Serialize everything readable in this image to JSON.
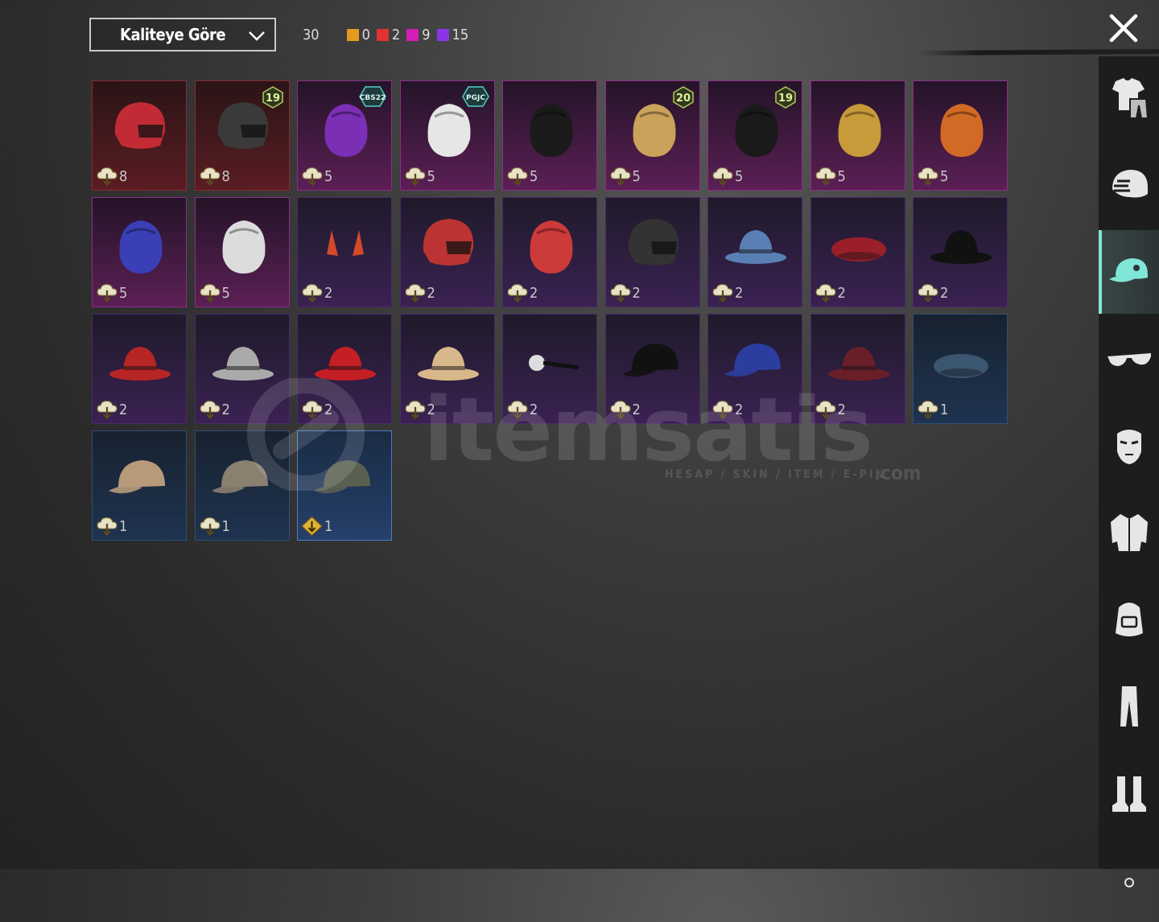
{
  "sort": {
    "label": "Kaliteye Göre"
  },
  "counts": {
    "total": "30",
    "by_quality": [
      {
        "color": "#e49a1c",
        "value": "0"
      },
      {
        "color": "#e23232",
        "value": "2"
      },
      {
        "color": "#d21fb6",
        "value": "9"
      },
      {
        "color": "#8a36e8",
        "value": "15"
      }
    ]
  },
  "items": [
    {
      "name": "red-tech-helmet",
      "quality": "red",
      "count": "8"
    },
    {
      "name": "black-red-helmet",
      "quality": "red",
      "count": "8",
      "badge": "19"
    },
    {
      "name": "purple-blue-hair",
      "quality": "pink",
      "count": "5",
      "badge": "CBS22"
    },
    {
      "name": "panda-mask",
      "quality": "pink",
      "count": "5",
      "badge": "PGJC"
    },
    {
      "name": "black-dreadlocks",
      "quality": "pink",
      "count": "5"
    },
    {
      "name": "blonde-hair-bunny-clip",
      "quality": "pink",
      "count": "5",
      "badge": "20"
    },
    {
      "name": "black-bun-hair",
      "quality": "pink",
      "count": "5",
      "badge": "19"
    },
    {
      "name": "golden-crown-headdress",
      "quality": "pink",
      "count": "5"
    },
    {
      "name": "orange-hair-tiara",
      "quality": "pink",
      "count": "5"
    },
    {
      "name": "blue-wolf-mask",
      "quality": "pink",
      "count": "5"
    },
    {
      "name": "silver-hair-crown",
      "quality": "pink",
      "count": "5"
    },
    {
      "name": "devil-horns",
      "quality": "purple",
      "count": "2"
    },
    {
      "name": "red-retro-helmet",
      "quality": "purple",
      "count": "2"
    },
    {
      "name": "red-white-beanie",
      "quality": "purple",
      "count": "2"
    },
    {
      "name": "luchador-mask",
      "quality": "purple",
      "count": "2"
    },
    {
      "name": "shark-hat",
      "quality": "purple",
      "count": "2"
    },
    {
      "name": "red-beret",
      "quality": "purple",
      "count": "2"
    },
    {
      "name": "black-top-hat",
      "quality": "purple",
      "count": "2"
    },
    {
      "name": "red-fedora",
      "quality": "purple",
      "count": "2"
    },
    {
      "name": "white-shark-hat",
      "quality": "purple",
      "count": "2"
    },
    {
      "name": "red-bucket-hat",
      "quality": "purple",
      "count": "2"
    },
    {
      "name": "cake-hat",
      "quality": "purple",
      "count": "2"
    },
    {
      "name": "head-mirror",
      "quality": "purple",
      "count": "2"
    },
    {
      "name": "black-cap",
      "quality": "purple",
      "count": "2"
    },
    {
      "name": "blue-cap",
      "quality": "purple",
      "count": "2"
    },
    {
      "name": "maroon-fedora",
      "quality": "purple",
      "count": "2"
    },
    {
      "name": "blue-beret",
      "quality": "blue",
      "count": "1"
    },
    {
      "name": "tan-cap",
      "quality": "blue",
      "count": "1"
    },
    {
      "name": "tan-blue-cap",
      "quality": "blue",
      "count": "1"
    },
    {
      "name": "camo-cap-headset",
      "quality": "blue-sel",
      "count": "1"
    }
  ],
  "watermark": {
    "word": "itemsatis",
    "sub": "HESAP / SKIN / ITEM / E-PIN",
    "com": ".com"
  },
  "sidebar": {
    "categories": [
      {
        "id": "outfit",
        "icon": "outfit-icon"
      },
      {
        "id": "helmet",
        "icon": "helmet-icon"
      },
      {
        "id": "hat",
        "icon": "cap-icon",
        "active": true
      },
      {
        "id": "glasses",
        "icon": "glasses-icon"
      },
      {
        "id": "mask",
        "icon": "mask-icon"
      },
      {
        "id": "jacket",
        "icon": "jacket-icon"
      },
      {
        "id": "backpack",
        "icon": "backpack-icon"
      },
      {
        "id": "pants",
        "icon": "pants-icon"
      },
      {
        "id": "boots",
        "icon": "boots-icon"
      }
    ]
  }
}
